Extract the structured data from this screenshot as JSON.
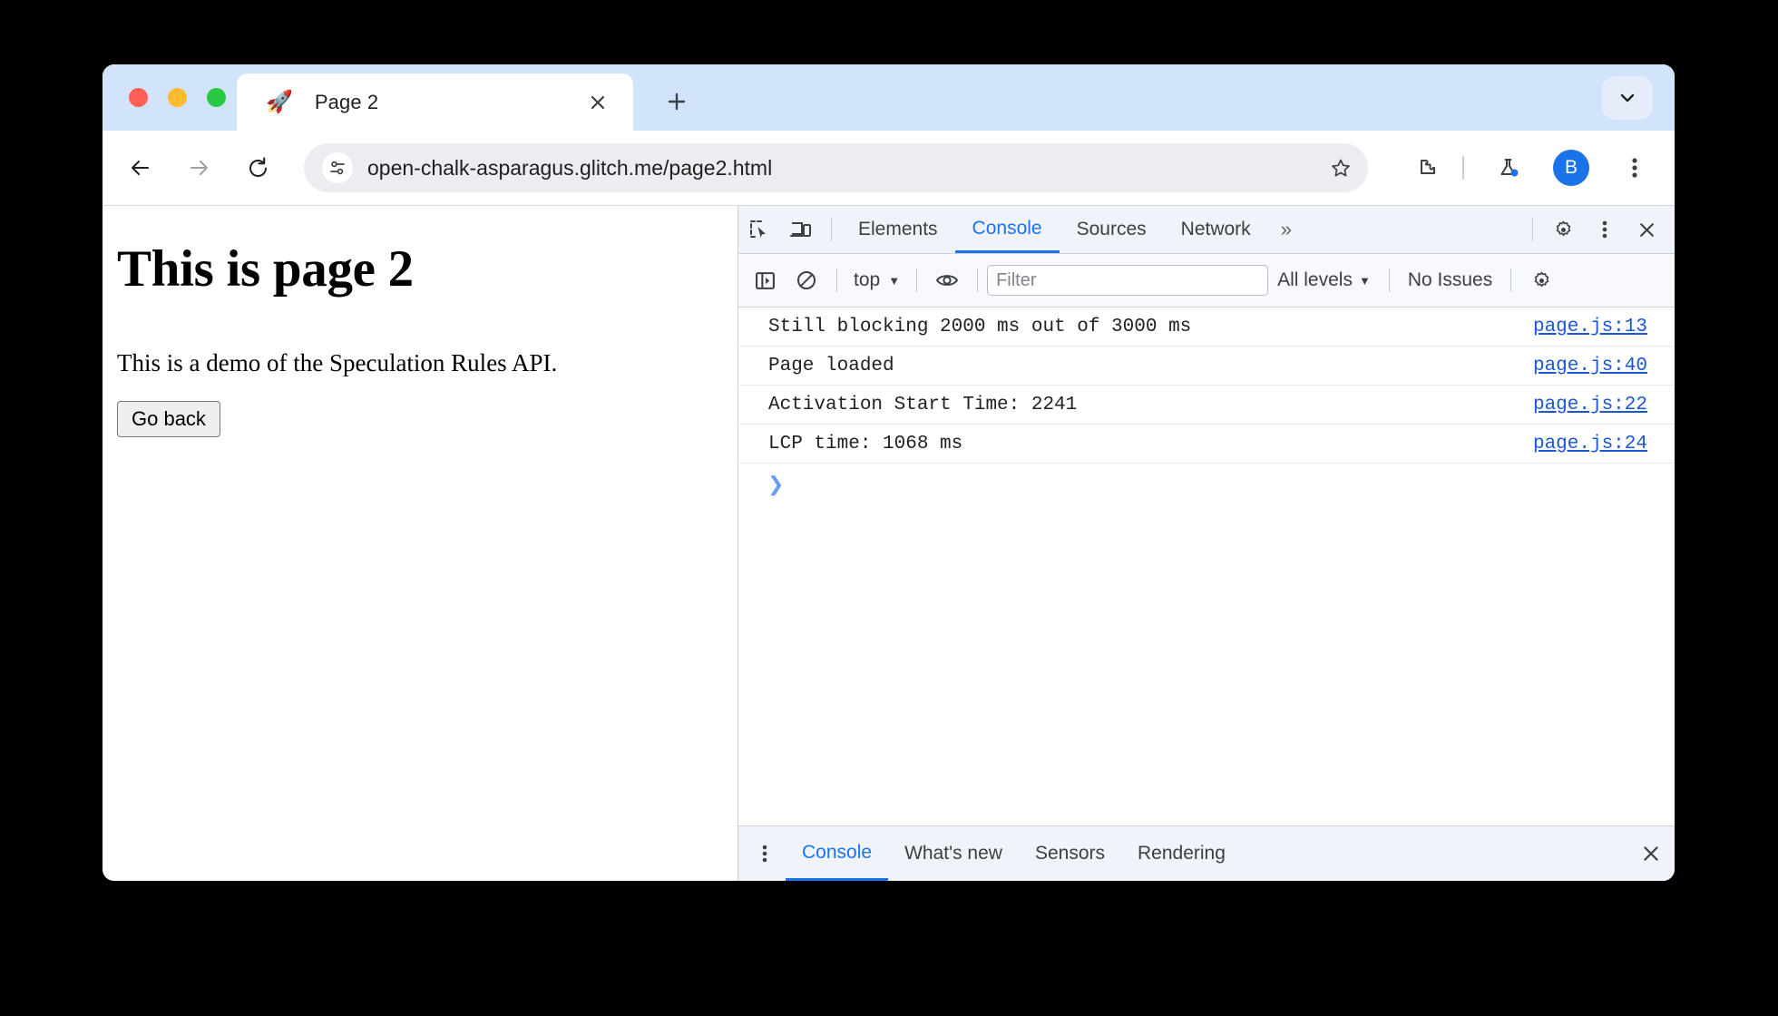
{
  "window": {
    "traffic_lights": [
      {
        "name": "close",
        "color": "#ff5f57"
      },
      {
        "name": "minimize",
        "color": "#febc2e"
      },
      {
        "name": "zoom",
        "color": "#28c840"
      }
    ]
  },
  "tabstrip": {
    "tab": {
      "favicon": "🚀",
      "title": "Page 2",
      "close_label": "×"
    },
    "new_tab_label": "+",
    "tab_search_icon": "chevron-down-icon"
  },
  "omnibox": {
    "url": "open-chalk-asparagus.glitch.me/page2.html",
    "site_info_icon": "tune-icon",
    "bookmark_icon": "star-icon",
    "extensions_icon": "puzzle-icon",
    "labs_icon": "flask-icon",
    "avatar_initial": "B",
    "menu_icon": "three-dot-vertical-icon",
    "back_icon": "arrow-left-icon",
    "forward_icon": "arrow-right-icon",
    "reload_icon": "reload-icon"
  },
  "page": {
    "heading": "This is page 2",
    "paragraph": "This is a demo of the Speculation Rules API.",
    "button_label": "Go back"
  },
  "devtools": {
    "inspect_icon": "inspect-element-icon",
    "device_icon": "device-toolbar-icon",
    "tabs": [
      {
        "label": "Elements",
        "active": false
      },
      {
        "label": "Console",
        "active": true
      },
      {
        "label": "Sources",
        "active": false
      },
      {
        "label": "Network",
        "active": false
      }
    ],
    "overflow_label": "»",
    "settings_icon": "gear-icon",
    "more_icon": "three-dot-vertical-icon",
    "close_icon": "close-icon",
    "filterbar": {
      "sidebar_icon": "show-console-sidebar-icon",
      "clear_icon": "clear-console-icon",
      "context": "top",
      "context_caret": "▼",
      "eye_icon": "live-expression-eye-icon",
      "filter_placeholder": "Filter",
      "filter_value": "",
      "levels": "All levels",
      "levels_caret": "▼",
      "issues": "No Issues",
      "settings_icon": "gear-icon"
    },
    "messages": [
      {
        "text": "Still blocking 2000 ms out of 3000 ms",
        "source": "page.js:13"
      },
      {
        "text": "Page loaded",
        "source": "page.js:40"
      },
      {
        "text": "Activation Start Time: 2241",
        "source": "page.js:22"
      },
      {
        "text": "LCP time: 1068 ms",
        "source": "page.js:24"
      }
    ],
    "prompt_symbol": "❯",
    "drawer": {
      "menu_icon": "three-dot-vertical-icon",
      "tabs": [
        {
          "label": "Console",
          "active": true
        },
        {
          "label": "What's new",
          "active": false
        },
        {
          "label": "Sensors",
          "active": false
        },
        {
          "label": "Rendering",
          "active": false
        }
      ],
      "close_icon": "close-icon"
    }
  },
  "colors": {
    "accent": "#1a73e8",
    "tabstrip_bg": "#d2e3fc",
    "omnibox_bg": "#ebedf2",
    "link": "#1a56d6"
  }
}
